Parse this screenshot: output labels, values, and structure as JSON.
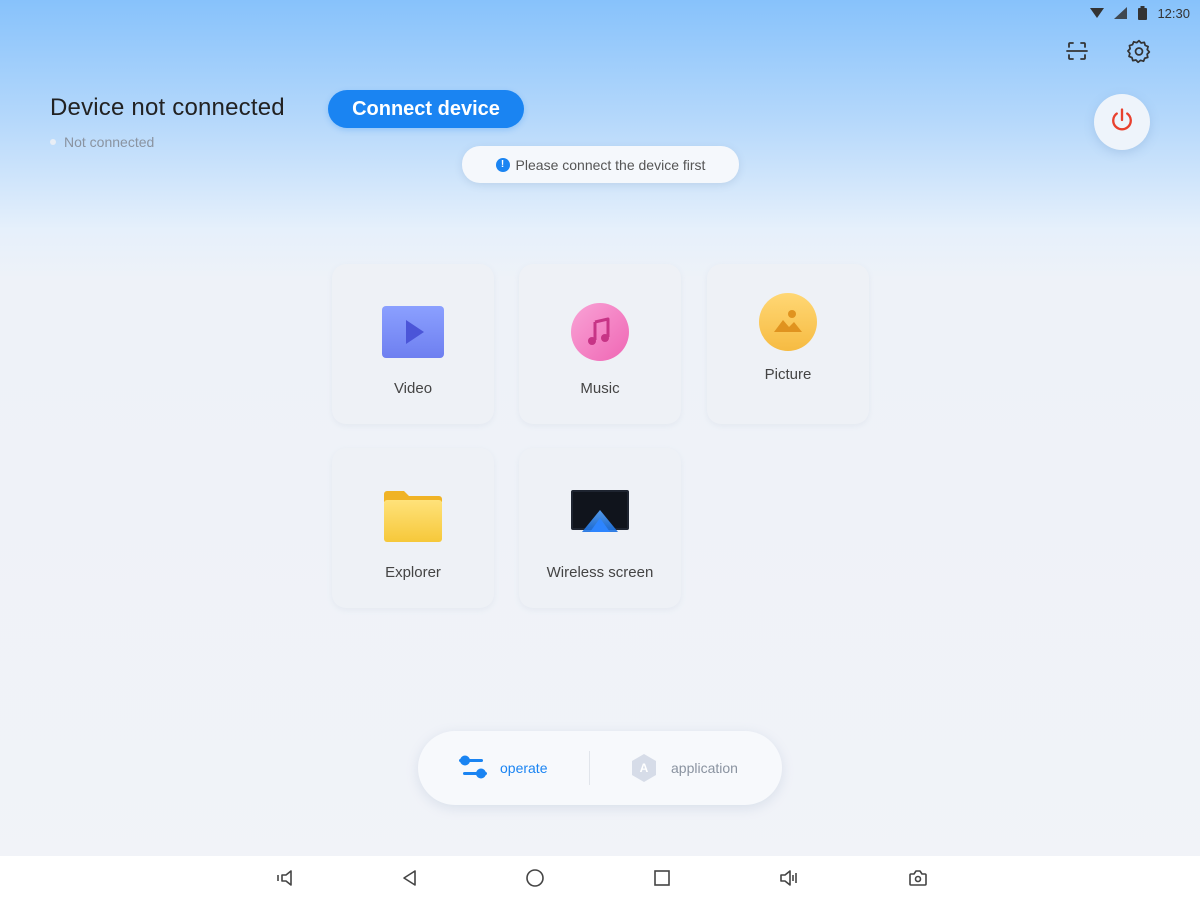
{
  "status_bar": {
    "time": "12:30",
    "icons": [
      "wifi-icon",
      "cellular-signal-icon",
      "battery-icon"
    ]
  },
  "toolbar": {
    "icons": [
      "scan-icon",
      "settings-gear-icon"
    ]
  },
  "header": {
    "title": "Device not connected",
    "status": "Not connected",
    "connect_button": "Connect device",
    "power_icon": "power-icon"
  },
  "toast": {
    "message": "Please connect the device first",
    "icon": "info-icon",
    "icon_glyph": "!"
  },
  "tiles": [
    {
      "label": "Video",
      "icon": "video-icon"
    },
    {
      "label": "Music",
      "icon": "music-icon"
    },
    {
      "label": "Picture",
      "icon": "picture-icon"
    },
    {
      "label": "Explorer",
      "icon": "folder-icon"
    },
    {
      "label": "Wireless screen",
      "icon": "wireless-screen-icon"
    }
  ],
  "bottom_tabs": [
    {
      "label": "operate",
      "icon": "sliders-icon",
      "active": true
    },
    {
      "label": "application",
      "icon": "application-icon",
      "icon_glyph": "A",
      "active": false
    }
  ],
  "nav_bar": [
    "volume-down-icon",
    "back-icon",
    "home-icon",
    "recents-icon",
    "volume-up-icon",
    "screenshot-icon"
  ],
  "colors": {
    "accent": "#1a84f2",
    "power_red": "#e8402e",
    "inactive_tab": "#8a93a0"
  }
}
